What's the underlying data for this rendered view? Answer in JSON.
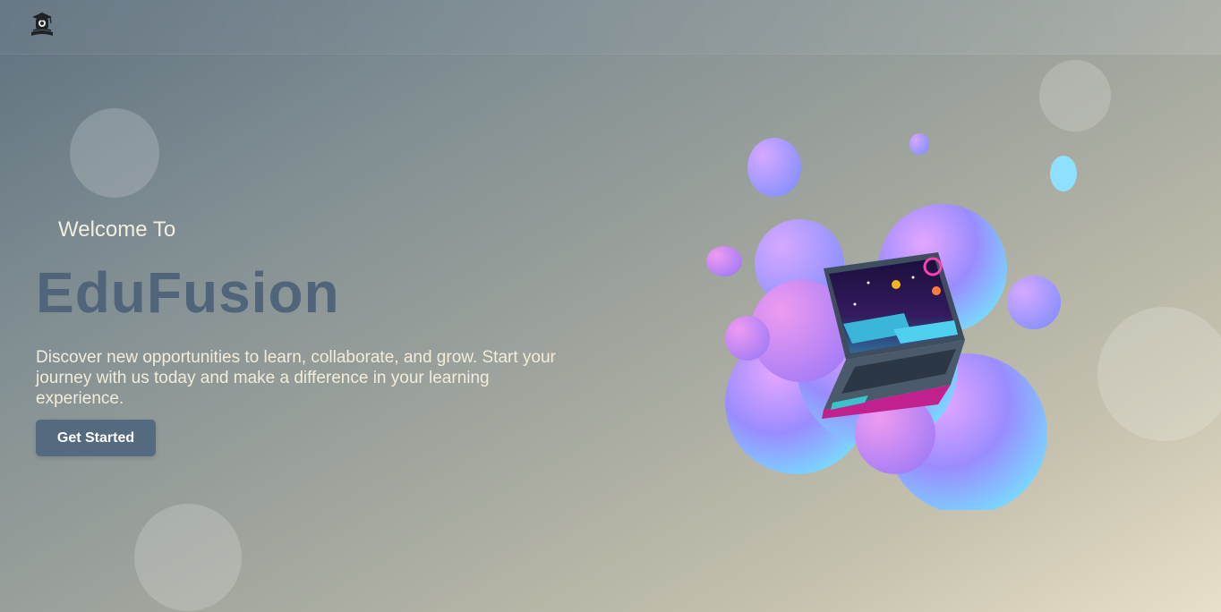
{
  "header": {
    "logo_icon": "graduation-cap-logo-icon"
  },
  "hero": {
    "welcome": "Welcome To",
    "brand": "EduFusion",
    "description": "Discover new opportunities to learn, collaborate, and grow. Start your journey with us today and make a difference in your learning experience.",
    "cta_label": "Get Started",
    "illustration_icon": "laptop-on-blob-illustration"
  },
  "colors": {
    "brand": "#506579",
    "button": "#546a7e",
    "text_light": "#f2eedf"
  }
}
